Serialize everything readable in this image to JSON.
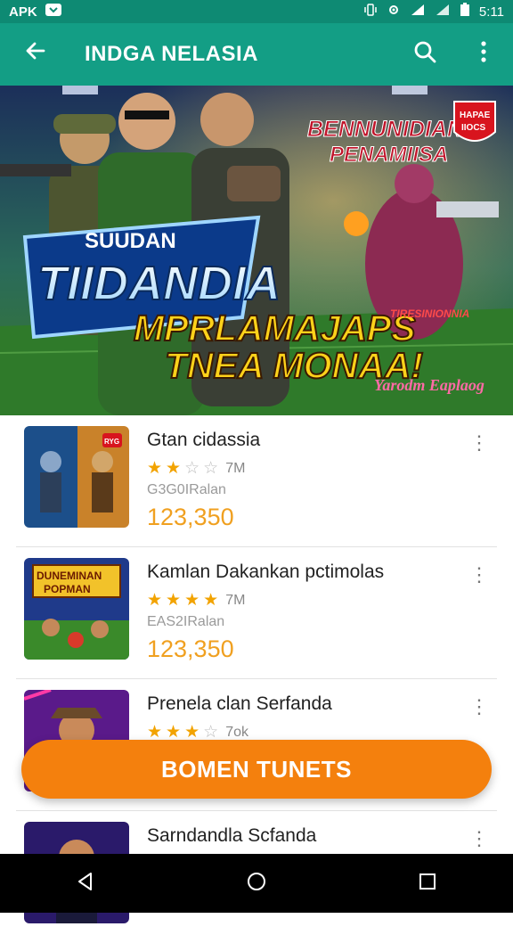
{
  "status": {
    "left_label": "APK",
    "time": "5:11"
  },
  "app_bar": {
    "title": "INDGA NELASIA",
    "back_icon": "arrow-back-icon",
    "search_icon": "search-icon",
    "menu_icon": "more-vert-icon"
  },
  "banner": {
    "badge_left_top": "SUUDAN",
    "logo": "TIIDANDIA",
    "headline_right_1": "BENNUNIDIAN",
    "headline_right_2": "PENAMIISA",
    "tagline_1": "MPRLAMAJAPS",
    "tagline_2": "TNEA MONAA!",
    "small_tag": "TIRESINIONNIA",
    "signature": "Yarodm Eaplaog",
    "shield_1": "HAPAE",
    "shield_2": "IIOCS"
  },
  "items": [
    {
      "name": "Gtan cidassia",
      "stars": 2,
      "rating_label": "7M",
      "sub": "G3G0IRalan",
      "price": "123,350",
      "thumb_badge": "RYG"
    },
    {
      "name": "Kamlan Dakankan pctimolas",
      "stars": 4,
      "rating_label": "7M",
      "sub": "EAS2IRalan",
      "price": "123,350",
      "thumb_title_1": "DUNEMINAN",
      "thumb_title_2": "POPMAN"
    },
    {
      "name": "Prenela clan Serfanda",
      "stars": 3,
      "rating_label": "7ok",
      "sub": "",
      "price": ""
    },
    {
      "name": "Sarndandla Scfanda",
      "stars": 0,
      "rating_label": "",
      "sub": "",
      "price": ""
    }
  ],
  "cta": {
    "label": "BOMEN TUNETS"
  },
  "colors": {
    "status_bar": "#0e8a73",
    "app_bar": "#139e85",
    "accent_orange": "#f4800d",
    "star": "#f2a300"
  }
}
